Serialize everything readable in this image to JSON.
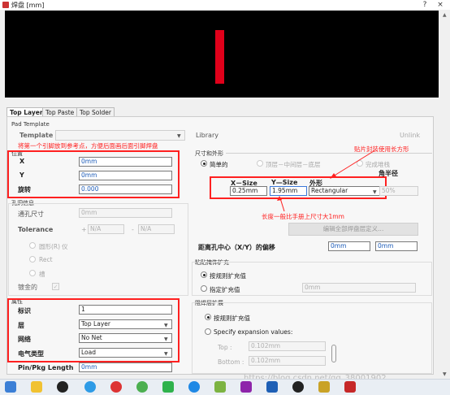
{
  "window": {
    "title": "焊盘 [mm]",
    "help": "?",
    "close": "×"
  },
  "tabs": [
    "Top Layer",
    "Top Paste",
    "Top Solder"
  ],
  "template": {
    "section": "Pad Template",
    "label": "Template",
    "library": "Library",
    "unlink": "Unlink"
  },
  "annotations": {
    "ref_point": "将第一个引脚放到参考点，方便后面画后面引脚焊盘",
    "smd_rect": "贴片封装使用长方形",
    "length_note": "长度一般比手册上尺寸大1mm",
    "watermark": "https://blog.csdn.net/qq_38001902"
  },
  "position": {
    "section": "位置",
    "x_label": "X",
    "x_value": "0mm",
    "y_label": "Y",
    "y_value": "0mm",
    "rot_label": "旋转",
    "rot_value": "0.000"
  },
  "hole": {
    "section": "孔洞信息",
    "size_label": "通孔尺寸",
    "size_value": "0mm",
    "tol_label": "Tolerance",
    "tol_plus": "+",
    "tol_plus_value": "N/A",
    "tol_minus": "-",
    "tol_minus_value": "N/A",
    "round": "圆形(R)",
    "round_suffix": "仪",
    "rect": "Rect",
    "slot": "槽",
    "plated": "镀金的"
  },
  "props": {
    "section": "属性",
    "designator_label": "标识",
    "designator_value": "1",
    "layer_label": "层",
    "layer_value": "Top Layer",
    "net_label": "网络",
    "net_value": "No Net",
    "elec_label": "电气类型",
    "elec_value": "Load",
    "pin_label": "Pin/Pkg Length",
    "pin_value": "0mm"
  },
  "shape": {
    "section": "尺寸和外形",
    "simple": "简单的",
    "top_mid_bottom": "顶层－中间层－底层",
    "full_stack": "完成堆栈",
    "corner_radius": "角半径",
    "x_size_header": "X－Size",
    "y_size_header": "Y—Size",
    "shape_header": "外形",
    "x_size": "0.25mm",
    "y_size": "1.95mm",
    "shape_value": "Rectangular",
    "radius_value": "50%",
    "edit_btn": "编辑全部焊盘层定义...",
    "offset_label": "距离孔中心（X/Y）的偏移",
    "offset_x": "0mm",
    "offset_y": "0mm"
  },
  "paste": {
    "section": "粘贴掩饰扩充",
    "by_rule": "按规则扩充值",
    "specify": "指定扩充值",
    "value": "0mm"
  },
  "solder": {
    "section": "阻焊层扩展",
    "by_rule": "按规则扩充值",
    "specify": "Specify expansion values:",
    "top_label": "Top :",
    "top_value": "0.102mm",
    "bottom_label": "Bottom :",
    "bottom_value": "0.102mm"
  }
}
